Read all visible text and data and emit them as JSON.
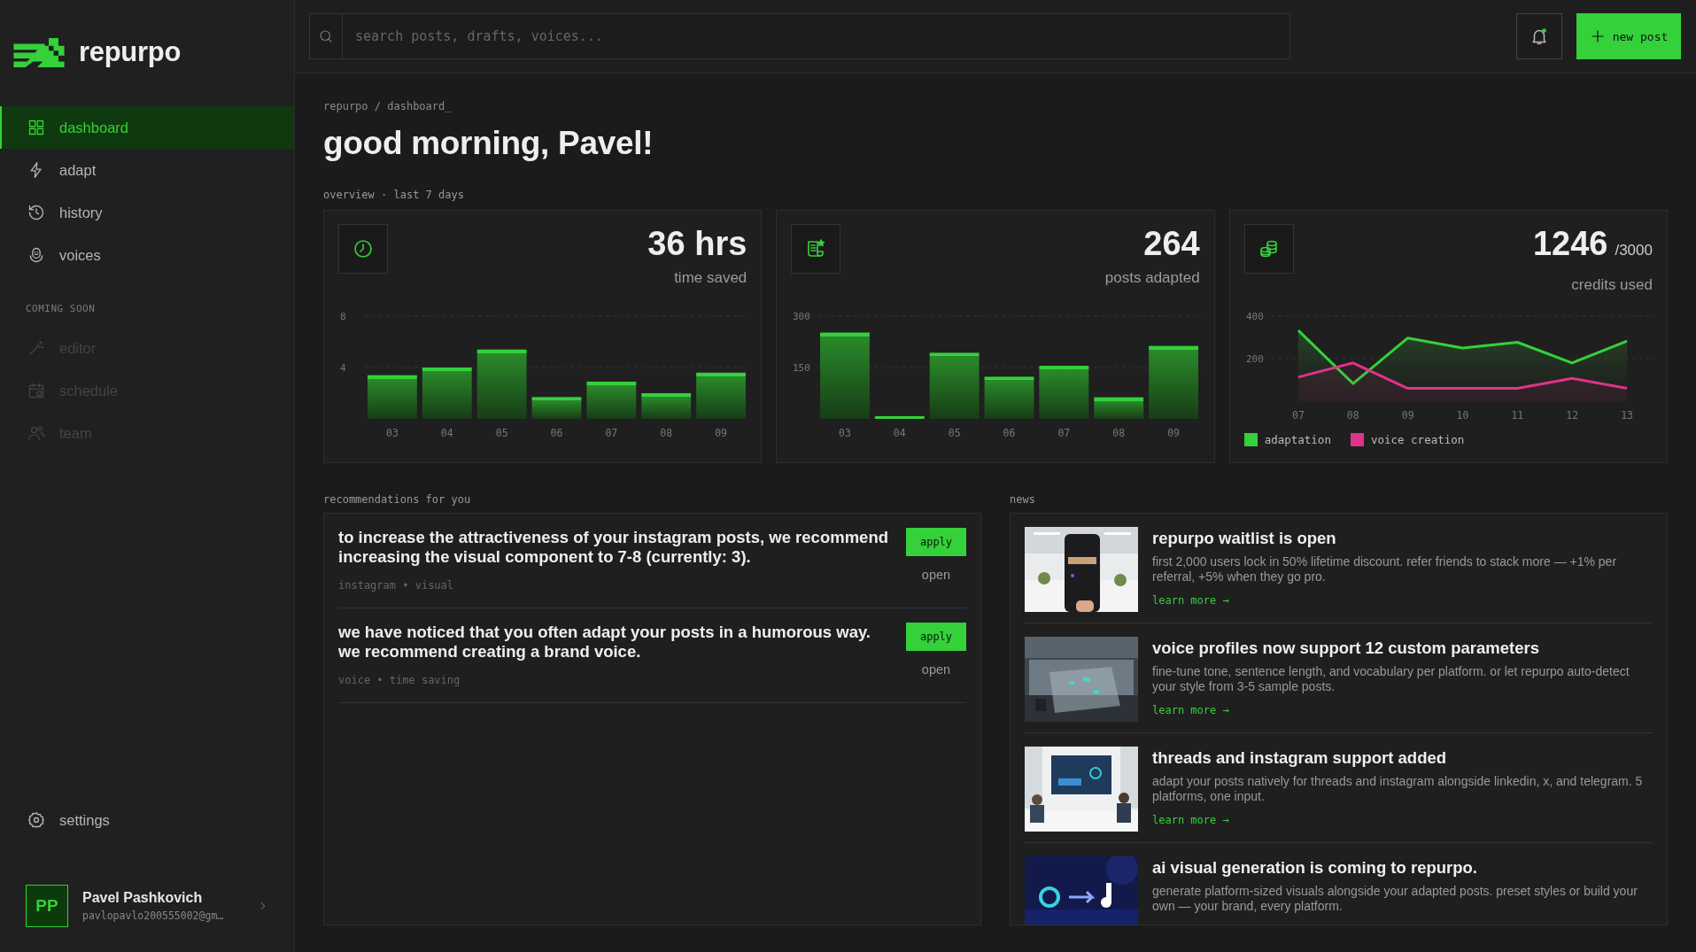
{
  "app": {
    "name": "repurpo"
  },
  "sidebar": {
    "nav": [
      {
        "label": "dashboard",
        "selected": true
      },
      {
        "label": "adapt",
        "selected": false
      },
      {
        "label": "history",
        "selected": false
      },
      {
        "label": "voices",
        "selected": false
      }
    ],
    "coming_soon": {
      "label": "COMING SOON",
      "items": [
        {
          "label": "editor",
          "disabled": true
        },
        {
          "label": "schedule",
          "disabled": true
        },
        {
          "label": "team",
          "disabled": true
        }
      ]
    },
    "settings": {
      "label": "settings"
    },
    "user": {
      "initials": "PP",
      "name": "Pavel Pashkovich",
      "email": "pavlopavlo200555002@gm…"
    }
  },
  "topbar": {
    "search": {
      "placeholder": "search posts, drafts, voices..."
    },
    "notifications": {
      "unread": true
    },
    "new_post": "new post"
  },
  "breadcrumb": "repurpo / dashboard_",
  "greeting": "good morning, Pavel!",
  "overview_label": "overview · last 7 days",
  "stats": [
    {
      "kind": "time",
      "value": "36 hrs",
      "label": "time saved",
      "chart_data": {
        "type": "bar",
        "categories": [
          "03",
          "04",
          "05",
          "06",
          "07",
          "08",
          "09"
        ],
        "values": [
          3.4,
          4.0,
          5.4,
          1.7,
          2.9,
          2.0,
          3.6
        ],
        "ylim": [
          0,
          8
        ],
        "yticks": [
          4,
          8
        ]
      }
    },
    {
      "kind": "posts",
      "value": "264",
      "label": "posts adapted",
      "chart_data": {
        "type": "bar",
        "categories": [
          "03",
          "04",
          "05",
          "06",
          "07",
          "08",
          "09"
        ],
        "values": [
          252,
          8,
          193,
          123,
          155,
          63,
          213
        ],
        "ylim": [
          0,
          300
        ],
        "yticks": [
          150,
          300
        ]
      }
    },
    {
      "kind": "credits",
      "value": "1246",
      "total": "/3000",
      "label": "credits used",
      "chart_data": {
        "type": "area",
        "x": [
          "07",
          "08",
          "09",
          "10",
          "11",
          "12",
          "13"
        ],
        "ylim": [
          0,
          400
        ],
        "yticks": [
          200,
          400
        ],
        "series": [
          {
            "name": "adaptation",
            "color": "#34d13a",
            "values": [
              333,
              83,
              297,
              250,
              277,
              180,
              283
            ]
          },
          {
            "name": "voice creation",
            "color": "#e0338a",
            "values": [
              113,
              180,
              60,
              60,
              60,
              107,
              60
            ]
          }
        ]
      }
    }
  ],
  "recommendations": {
    "title": "recommendations for you",
    "items": [
      {
        "text": "to increase the attractiveness of your instagram posts, we recommend increasing the visual component to 7-8 (currently: 3).",
        "tags": "instagram • visual",
        "apply": "apply",
        "open": "open"
      },
      {
        "text": "we have noticed that you often adapt your posts in a humorous way. we recommend creating a brand voice.",
        "tags": "voice • time saving",
        "apply": "apply",
        "open": "open"
      }
    ]
  },
  "news": {
    "title": "news",
    "items": [
      {
        "title": "repurpo waitlist is open",
        "body": "first 2,000 users lock in 50% lifetime discount. refer friends to stack more — +1% per referral, +5% when they go pro.",
        "link": "learn more →"
      },
      {
        "title": "voice profiles now support 12 custom parameters",
        "body": "fine-tune tone, sentence length, and vocabulary per platform. or let repurpo auto-detect your style from 3-5 sample posts.",
        "link": "learn more →"
      },
      {
        "title": "threads and instagram support added",
        "body": "adapt your posts natively for threads and instagram alongside linkedin, x, and telegram. 5 platforms, one input.",
        "link": "learn more →"
      },
      {
        "title": "ai visual generation is coming to repurpo.",
        "body": "generate platform-sized visuals alongside your adapted posts. preset styles or build your own — your brand, every platform."
      }
    ]
  }
}
